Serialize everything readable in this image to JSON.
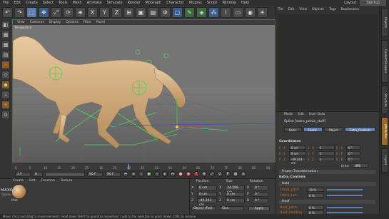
{
  "menubar": {
    "items": [
      "File",
      "Edit",
      "Create",
      "Select",
      "Tools",
      "Mesh",
      "Animate",
      "Simulate",
      "Render",
      "MoGraph",
      "Character",
      "Plugins",
      "Script",
      "Window",
      "Help"
    ],
    "layout_label": "Layout:",
    "layout_value": "Startup"
  },
  "viewport": {
    "menu": [
      "View",
      "Cameras",
      "Display",
      "Options",
      "Filter",
      "Panel"
    ],
    "label": "Perspective"
  },
  "timeline": {
    "ticks": [
      "0",
      "5",
      "10",
      "15",
      "20",
      "25",
      "30",
      "35",
      "40",
      "45",
      "50",
      "55",
      "60",
      "65",
      "70",
      "75",
      "80",
      "85",
      "90"
    ]
  },
  "transport": {
    "start_frame": "1 F",
    "current_frame": "0",
    "end_frame": "90 F",
    "preview_frame": "90 F"
  },
  "material": {
    "menu": [
      "Create",
      "Edit",
      "Function",
      "Texture"
    ],
    "material_name": "Mat",
    "logo_line1": "MAXON",
    "logo_line2": "CINEMA 4D"
  },
  "coordinates": {
    "headers": [
      "Position",
      "Size",
      "Rotation"
    ],
    "rows": [
      {
        "axis": "X",
        "pos": "0 cm",
        "size": "34.298 cm",
        "rot_label": "H",
        "rot": "0 °"
      },
      {
        "axis": "Y",
        "pos": "0 cm",
        "size": "0 cm",
        "rot_label": "P",
        "rot": "0 °"
      },
      {
        "axis": "Z",
        "pos": "-49.243 cm",
        "size": "0 cm",
        "rot_label": "B",
        "rot": "0 °"
      }
    ],
    "mode_select": "Object (Rel)",
    "size_select": "Size",
    "apply_label": "Apply"
  },
  "object_manager": {
    "menu": [
      "File",
      "Edit",
      "View",
      "Objects",
      "Tags",
      "Bookmarks"
    ]
  },
  "attributes": {
    "menu": [
      "Mode",
      "Edit",
      "User Data"
    ],
    "object_name": "Spline [extra_pelvis_stuff]",
    "tabs": [
      {
        "label": "Basic",
        "active": false
      },
      {
        "label": "Coord.",
        "active": true
      },
      {
        "label": "Object",
        "active": false
      },
      {
        "label": "Extra_Controls",
        "active": true
      }
    ],
    "coord_header": "Coordinates",
    "coord_rows": [
      {
        "p_label": "P . X",
        "p_val": "0 cm",
        "s_label": "S . X",
        "s_val": "1",
        "r_label": "R . H",
        "r_val": "0 °"
      },
      {
        "p_label": "P . Y",
        "p_val": "0 cm",
        "s_label": "S . Y",
        "s_val": "1",
        "r_label": "R . P",
        "r_val": "0 °"
      },
      {
        "p_label": "P . Z",
        "p_val": "-49.243 cm",
        "s_label": "S . Z",
        "s_val": "1",
        "r_label": "R . B",
        "r_val": "0 °"
      }
    ],
    "order_label": "Order",
    "order_value": "HPB",
    "extra_header": "Extra_Controls",
    "group_transformations": "Frozen Transformation",
    "group_hold": "Hold",
    "hold_rows": [
      {
        "label": "Ydock_pitch",
        "value": "10 %"
      },
      {
        "label": "Ydock_turn",
        "value": "0 %"
      }
    ],
    "group_hoof": "Hoof",
    "hoof_rows": [
      {
        "label": "Hoof_pitch",
        "value": "0 %"
      },
      {
        "label": "Hoof_heading",
        "value": "0 %"
      }
    ]
  },
  "right_tabs": [
    "Objects",
    "Content Browser",
    "Structure",
    "Attributes",
    "Layers"
  ],
  "statusbar": {
    "text": "Move: Click and drag to move elements. Hold down SHIFT to quantize movement / add to the selection in point mode, CTRL to remove."
  },
  "colors": {
    "accent": "#5a80b5",
    "highlight_orange": "#d26f2f",
    "viewport_border": "#b83b3b"
  }
}
